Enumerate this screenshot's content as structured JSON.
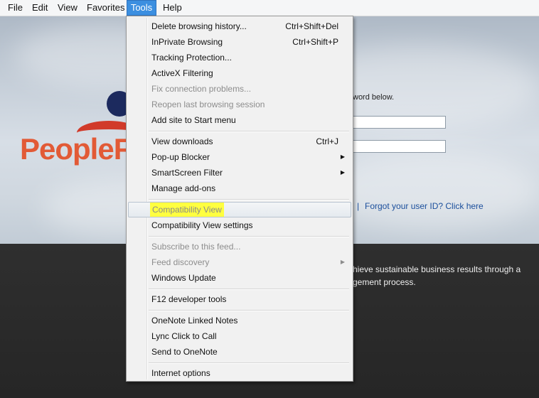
{
  "menubar": {
    "items": [
      {
        "label": "File"
      },
      {
        "label": "Edit"
      },
      {
        "label": "View"
      },
      {
        "label": "Favorites"
      },
      {
        "label": "Tools"
      },
      {
        "label": "Help"
      }
    ]
  },
  "page": {
    "logo_text": "PeopleF",
    "instructions": "word below.",
    "separator": "|",
    "forgot_link": "Forgot your user ID? Click here",
    "promo_line1": "hieve sustainable business results through a",
    "promo_line2": "gement process."
  },
  "tools_menu": {
    "items": [
      {
        "label": "Delete browsing history...",
        "shortcut": "Ctrl+Shift+Del"
      },
      {
        "label": "InPrivate Browsing",
        "shortcut": "Ctrl+Shift+P"
      },
      {
        "label": "Tracking Protection..."
      },
      {
        "label": "ActiveX Filtering"
      },
      {
        "label": "Fix connection problems...",
        "disabled": true
      },
      {
        "label": "Reopen last browsing session",
        "disabled": true
      },
      {
        "label": "Add site to Start menu"
      },
      {
        "label": "View downloads",
        "shortcut": "Ctrl+J"
      },
      {
        "label": "Pop-up Blocker",
        "submenu": true
      },
      {
        "label": "SmartScreen Filter",
        "submenu": true
      },
      {
        "label": "Manage add-ons"
      },
      {
        "label": "Compatibility View",
        "highlighted": true
      },
      {
        "label": "Compatibility View settings"
      },
      {
        "label": "Subscribe to this feed...",
        "disabled": true
      },
      {
        "label": "Feed discovery",
        "disabled": true,
        "submenu": true
      },
      {
        "label": "Windows Update"
      },
      {
        "label": "F12 developer tools"
      },
      {
        "label": "OneNote Linked Notes"
      },
      {
        "label": "Lync Click to Call"
      },
      {
        "label": "Send to OneNote"
      },
      {
        "label": "Internet options"
      }
    ],
    "submenu_arrow": "▶"
  },
  "colors": {
    "menubar_active": "#3c8fe0",
    "highlight_marker": "#ffff40",
    "link": "#1b4f9c",
    "logo": "#e25a36"
  }
}
